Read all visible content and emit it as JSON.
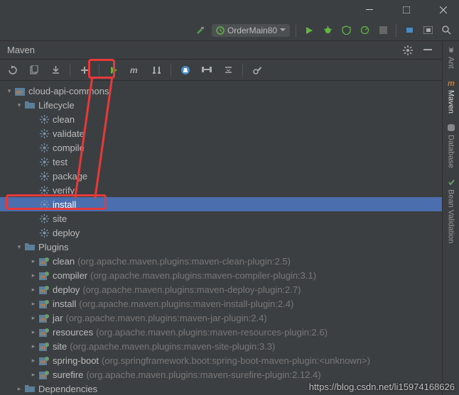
{
  "toolbar": {
    "run_config_label": "OrderMain80"
  },
  "panel": {
    "title": "Maven"
  },
  "tree": {
    "project": "cloud-api-commons",
    "lifecycle_label": "Lifecycle",
    "lifecycle": [
      "clean",
      "validate",
      "compile",
      "test",
      "package",
      "verify",
      "install",
      "site",
      "deploy"
    ],
    "selected_lifecycle": "install",
    "plugins_label": "Plugins",
    "plugins": [
      {
        "name": "clean",
        "desc": "(org.apache.maven.plugins:maven-clean-plugin:2.5)"
      },
      {
        "name": "compiler",
        "desc": "(org.apache.maven.plugins:maven-compiler-plugin:3.1)"
      },
      {
        "name": "deploy",
        "desc": "(org.apache.maven.plugins:maven-deploy-plugin:2.7)"
      },
      {
        "name": "install",
        "desc": "(org.apache.maven.plugins:maven-install-plugin:2.4)"
      },
      {
        "name": "jar",
        "desc": "(org.apache.maven.plugins:maven-jar-plugin:2.4)"
      },
      {
        "name": "resources",
        "desc": "(org.apache.maven.plugins:maven-resources-plugin:2.6)"
      },
      {
        "name": "site",
        "desc": "(org.apache.maven.plugins:maven-site-plugin:3.3)"
      },
      {
        "name": "spring-boot",
        "desc": "(org.springframework.boot:spring-boot-maven-plugin:<unknown>)"
      },
      {
        "name": "surefire",
        "desc": "(org.apache.maven.plugins:maven-surefire-plugin:2.12.4)"
      }
    ],
    "dependencies_label": "Dependencies"
  },
  "right_tabs": [
    "Ant",
    "Maven",
    "Database",
    "Bean Validation"
  ],
  "active_right_tab": "Maven",
  "watermark": "https://blog.csdn.net/li15974168626"
}
